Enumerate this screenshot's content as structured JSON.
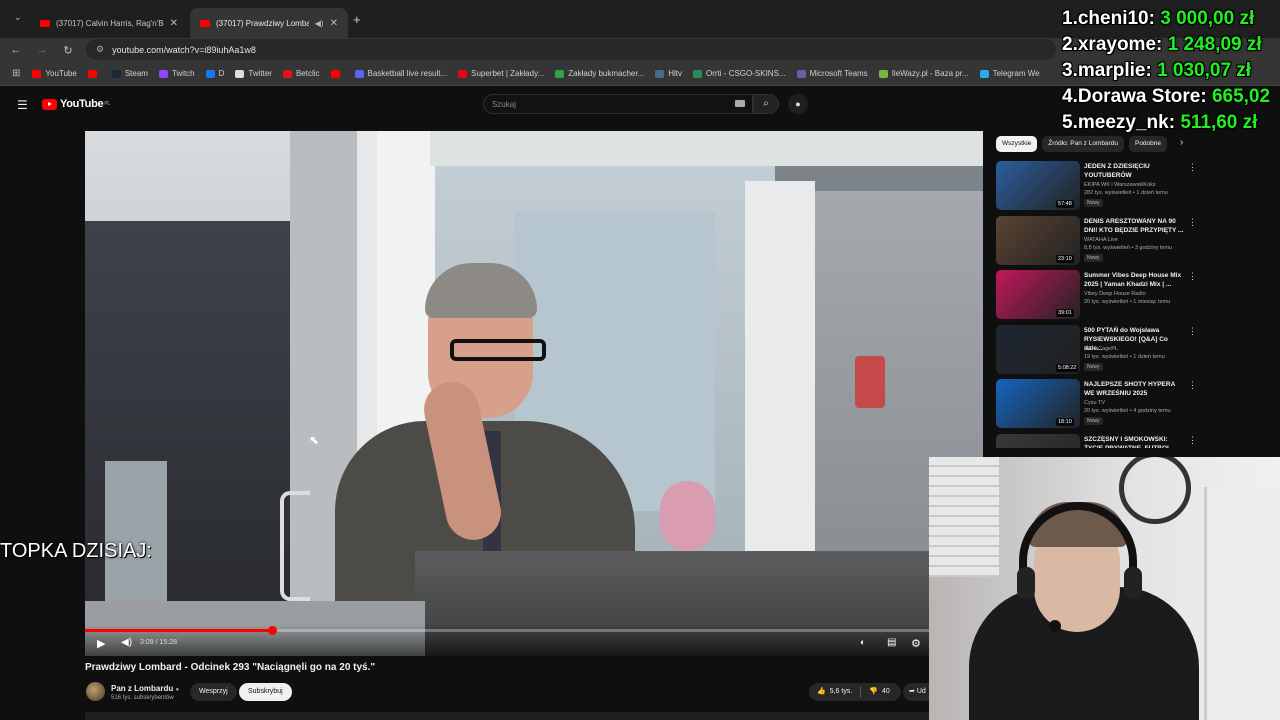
{
  "browser": {
    "tabs": [
      {
        "label": "(37017) Calvin Harris, Rag'n'Bone",
        "active": false
      },
      {
        "label": "(37017) Prawdziwy Lombard",
        "active": true
      }
    ],
    "new_tab": "+",
    "url": "youtube.com/watch?v=i89iuhAa1w8",
    "bookmarks": [
      {
        "label": "YouTube",
        "color": "#ff0000"
      },
      {
        "label": "",
        "color": "#ff0000"
      },
      {
        "label": "Steam",
        "color": "#1b2838"
      },
      {
        "label": "Twitch",
        "color": "#9146ff"
      },
      {
        "label": "D",
        "color": "#1877f2"
      },
      {
        "label": "Twitter",
        "color": "#dddddd"
      },
      {
        "label": "Betclic",
        "color": "#e5101d"
      },
      {
        "label": "",
        "color": "#ff0000"
      },
      {
        "label": "Basketball live result...",
        "color": "#5b63f0"
      },
      {
        "label": "Superbet | Zakłady...",
        "color": "#e30613"
      },
      {
        "label": "Zakłady bukmacher...",
        "color": "#2da44e"
      },
      {
        "label": "Hltv",
        "color": "#4a6b8a"
      },
      {
        "label": "Orrti - CSGO-SKINS...",
        "color": "#2e8b57"
      },
      {
        "label": "Microsoft Teams",
        "color": "#6264a7"
      },
      {
        "label": "IleWazy.pl - Baza pr...",
        "color": "#7cb342"
      },
      {
        "label": "Telegram We",
        "color": "#2aabee"
      }
    ]
  },
  "youtube": {
    "logo_text": "YouTube",
    "logo_region": "PL",
    "search_placeholder": "Szukaj",
    "video": {
      "time": "3:09 / 15:28",
      "progress": 0.208,
      "title": "Prawdziwy Lombard - Odcinek 293 \"Naciągnęli go na 20 tyś.\"",
      "channel": "Pan z Lombardu",
      "subscribers": "516 tys. subskrybentów",
      "support_label": "Wesprzyj",
      "subscribe_label": "Subskrybuj",
      "likes": "5,6 tys.",
      "dislikes": "40",
      "share_label": "Ud"
    },
    "chips": [
      "Wszystkie",
      "Źródło: Pan z Lombardu",
      "Podobne"
    ],
    "recommendations": [
      {
        "title": "JEDEN Z DZIESIĘCIU YOUTUBERÓW",
        "channel": "EKIPA WK i WarszawskiKoks",
        "meta": "282 tys. wyświetleń • 1 dzień temu",
        "badge": "Nowy",
        "duration": "57:48",
        "thumb_color": "#2b5fa0"
      },
      {
        "title": "DENIS ARESZTOWANY NA 90 DNI! KTO BĘDZIE PRZYPIĘTY ...",
        "channel": "WATAHA Live",
        "meta": "8,8 tys. wyświetleń • 3 godziny temu",
        "badge": "Nowy",
        "duration": "23:10",
        "thumb_color": "#5c4433"
      },
      {
        "title": "Summer Vibes Deep House Mix 2025 | Yaman Khadzi Mix | ...",
        "channel": "Vibey Deep House Radio",
        "meta": "20 tys. wyświetleń • 1 miesiąc temu",
        "badge": "",
        "duration": "39:01",
        "thumb_color": "#c2185b"
      },
      {
        "title": "500 PYTAŃ do Wojsława RYSIEWSKIEGO! [Q&A] Co dale...",
        "channel": "InTheCagePL",
        "meta": "19 tys. wyświetleń • 1 dzień temu",
        "badge": "Nowy",
        "duration": "5:08:22",
        "thumb_color": "#1c2530"
      },
      {
        "title": "NAJLEPSZE SHOTY HYPERA WE WRZEŚNIU 2025",
        "channel": "Cysu TV",
        "meta": "20 tys. wyświetleń • 4 godziny temu",
        "badge": "Nowy",
        "duration": "18:10",
        "thumb_color": "#1565c0"
      },
      {
        "title": "SZCZĘSNY I SMOKOWSKI: ŻYCIE PRYWATNE, FUTBOL",
        "channel": "",
        "meta": "",
        "badge": "",
        "duration": "",
        "thumb_color": "#3a3a3a"
      }
    ]
  },
  "overlay": {
    "leaderboard": [
      {
        "rank": "1.",
        "name": "cheni10:",
        "amount": "3 000,00 zł"
      },
      {
        "rank": "2.",
        "name": "xrayome:",
        "amount": "1 248,09 zł"
      },
      {
        "rank": "3.",
        "name": "marplie:",
        "amount": "1 030,07 zł"
      },
      {
        "rank": "4.",
        "name": "Dorawa Store:",
        "amount": "665,02"
      },
      {
        "rank": "5.",
        "name": "meezy_nk:",
        "amount": "511,60 zł"
      }
    ],
    "topka_label": "TOPKA DZISIAJ:"
  }
}
